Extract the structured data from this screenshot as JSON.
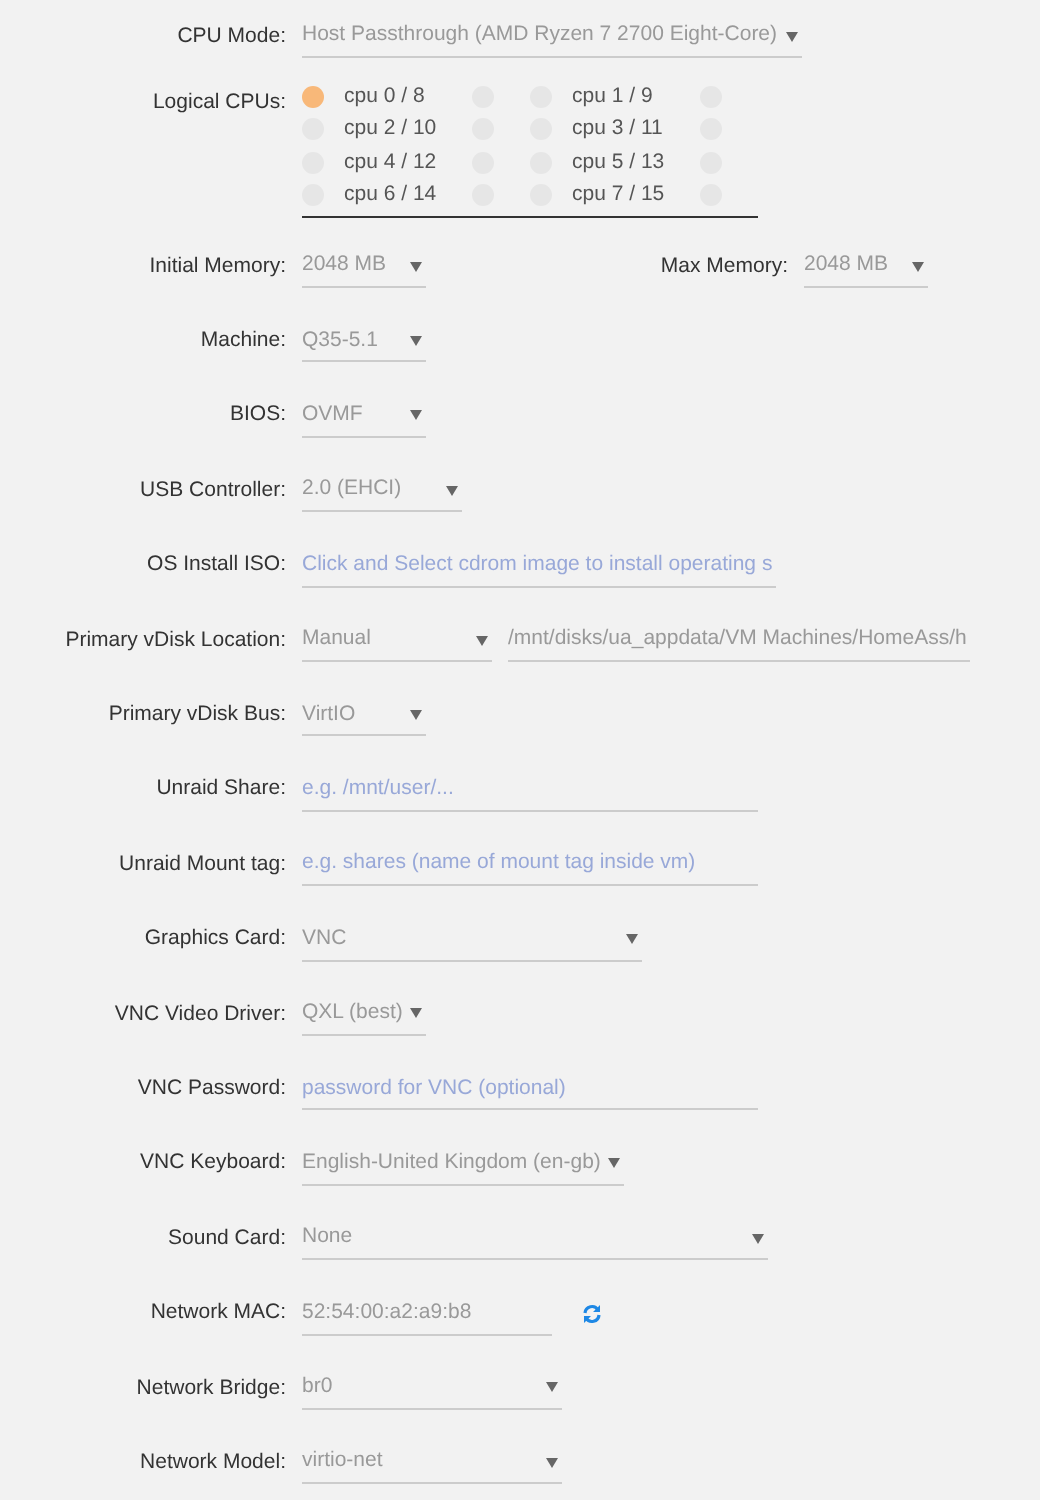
{
  "rows": [
    {
      "kind": "select",
      "label": "CPU Mode:",
      "value": "Host Passthrough (AMD Ryzen 7 2700 Eight-Core)"
    },
    {
      "kind": "cpus",
      "label": "Logical CPUs:",
      "cpus": [
        {
          "label": "cpu 0 / 8",
          "checked": true,
          "thread_checked": false
        },
        {
          "label": "cpu 1 / 9",
          "checked": false,
          "thread_checked": false
        },
        {
          "label": "cpu 2 / 10",
          "checked": false,
          "thread_checked": false
        },
        {
          "label": "cpu 3 / 11",
          "checked": false,
          "thread_checked": false
        },
        {
          "label": "cpu 4 / 12",
          "checked": false,
          "thread_checked": false
        },
        {
          "label": "cpu 5 / 13",
          "checked": false,
          "thread_checked": false
        },
        {
          "label": "cpu 6 / 14",
          "checked": false,
          "thread_checked": false
        },
        {
          "label": "cpu 7 / 15",
          "checked": false,
          "thread_checked": false
        }
      ]
    },
    {
      "kind": "select",
      "label": "Initial Memory:",
      "value": "2048 MB",
      "second": {
        "label": "Max Memory:",
        "value": "2048 MB"
      }
    },
    {
      "kind": "select",
      "label": "Machine:",
      "value": "Q35-5.1"
    },
    {
      "kind": "select",
      "label": "BIOS:",
      "value": "OVMF"
    },
    {
      "kind": "select",
      "label": "USB Controller:",
      "value": "2.0 (EHCI)"
    },
    {
      "kind": "input",
      "label": "OS Install ISO:",
      "placeholder": "Click and Select cdrom image to install operating s"
    },
    {
      "kind": "select",
      "label": "Primary vDisk Location:",
      "value": "Manual",
      "path": "/mnt/disks/ua_appdata/VM Machines/HomeAss/h"
    },
    {
      "kind": "select",
      "label": "Primary vDisk Bus:",
      "value": "VirtIO"
    },
    {
      "kind": "input",
      "label": "Unraid Share:",
      "placeholder": "e.g. /mnt/user/..."
    },
    {
      "kind": "input",
      "label": "Unraid Mount tag:",
      "placeholder": "e.g. shares (name of mount tag inside vm)"
    },
    {
      "kind": "select",
      "label": "Graphics Card:",
      "value": "VNC"
    },
    {
      "kind": "select",
      "label": "VNC Video Driver:",
      "value": "QXL (best)"
    },
    {
      "kind": "input",
      "label": "VNC Password:",
      "placeholder": "password for VNC (optional)"
    },
    {
      "kind": "select",
      "label": "VNC Keyboard:",
      "value": "English-United Kingdom (en-gb)"
    },
    {
      "kind": "select",
      "label": "Sound Card:",
      "value": "None"
    },
    {
      "kind": "mac",
      "label": "Network MAC:",
      "value": "52:54:00:a2:a9:b8"
    },
    {
      "kind": "select",
      "label": "Network Bridge:",
      "value": "br0"
    },
    {
      "kind": "select",
      "label": "Network Model:",
      "value": "virtio-net"
    }
  ]
}
